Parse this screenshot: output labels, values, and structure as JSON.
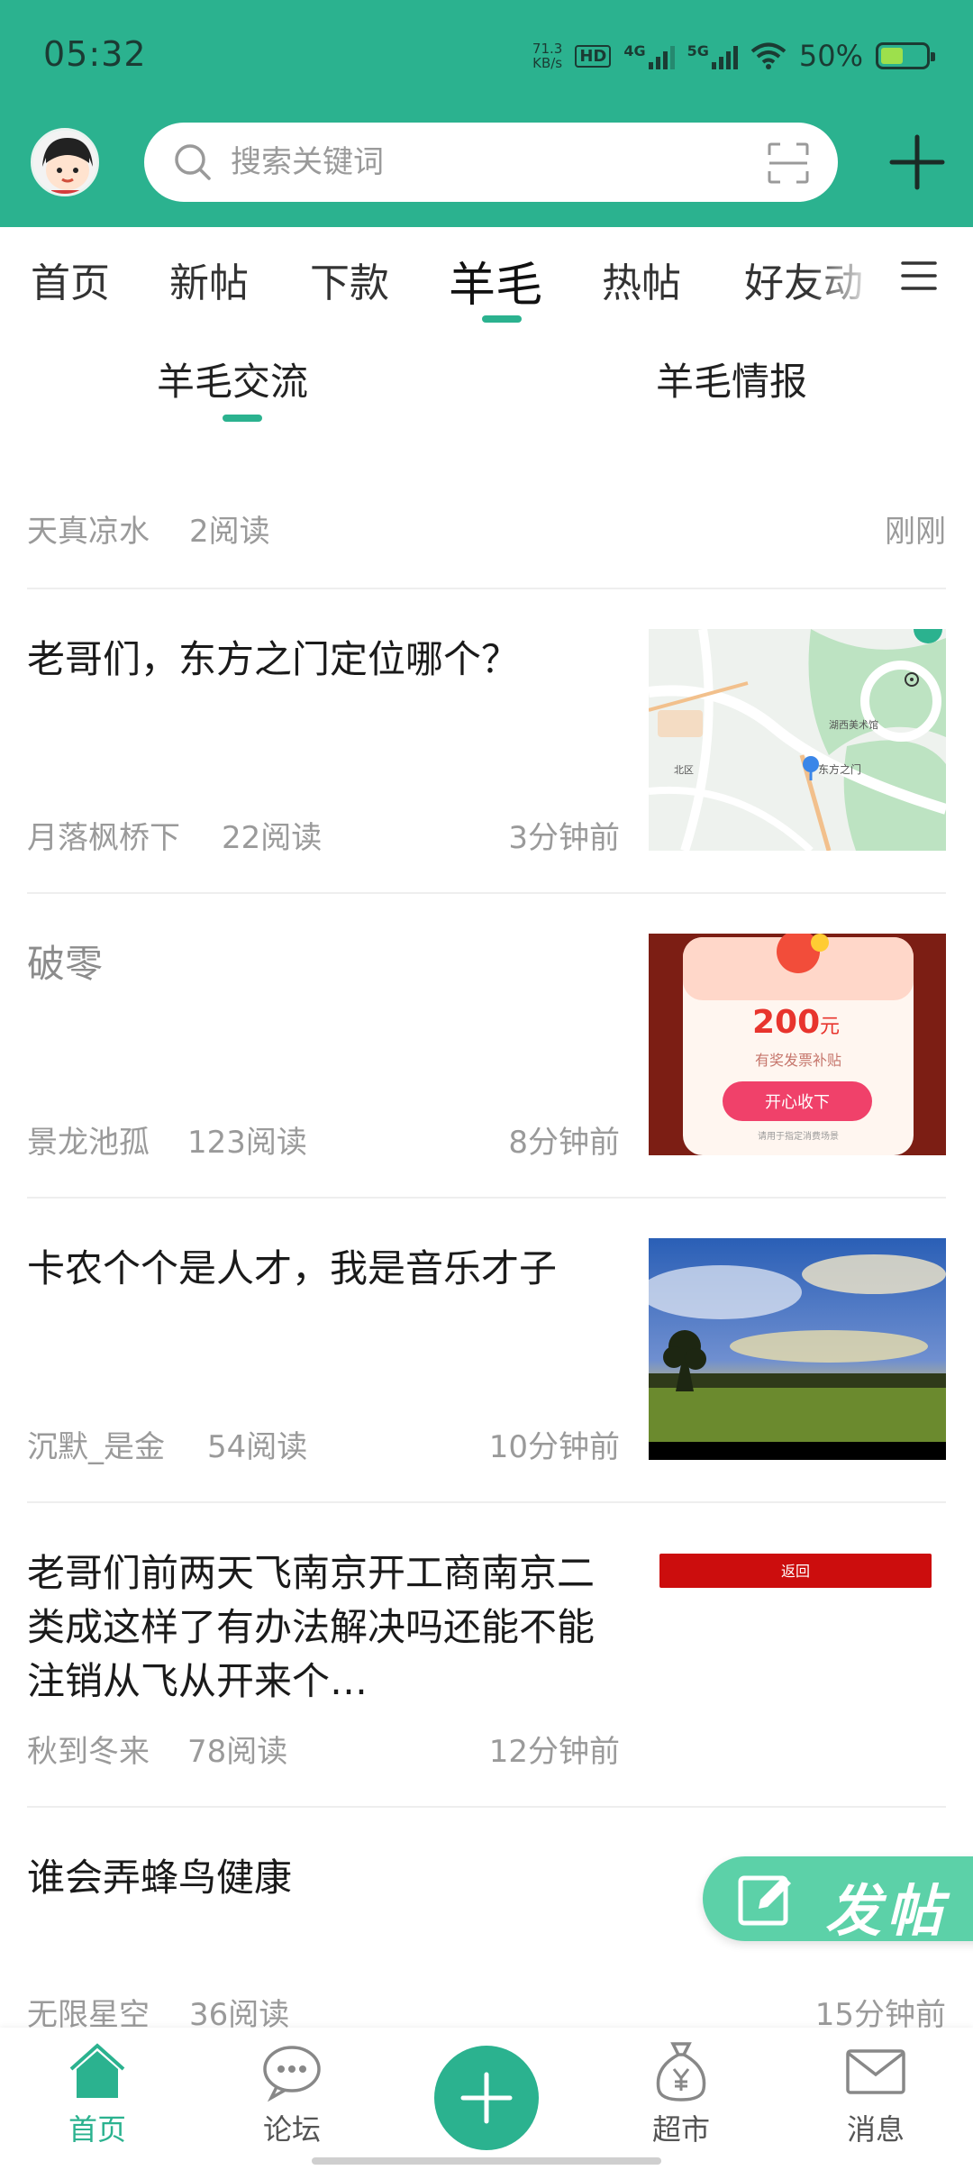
{
  "status_bar": {
    "time": "05:32",
    "net_speed_value": "71.3",
    "net_speed_unit": "KB/s",
    "hd_badge": "HD",
    "signal_1": "4G",
    "signal_2": "5G",
    "battery_percent": "50%",
    "battery_level": 0.5
  },
  "header": {
    "search_placeholder": "搜索关键词",
    "accent_color": "#2bb28f"
  },
  "tabs": [
    {
      "label": "首页"
    },
    {
      "label": "新帖"
    },
    {
      "label": "下款"
    },
    {
      "label": "羊毛",
      "active": true
    },
    {
      "label": "热帖"
    },
    {
      "label": "好友动"
    }
  ],
  "subtabs": [
    {
      "label": "羊毛交流",
      "active": true
    },
    {
      "label": "羊毛情报"
    }
  ],
  "pinned": {
    "author": "天真凉水",
    "reads": "2阅读",
    "time": "刚刚"
  },
  "posts": [
    {
      "title": "老哥们，东方之门定位哪个？",
      "author": "月落枫桥下",
      "reads": "22阅读",
      "time": "3分钟前",
      "thumb": "map-thumb"
    },
    {
      "title": "破零",
      "author": "景龙池孤",
      "reads": "123阅读",
      "time": "8分钟前",
      "thumb": "redpacket-thumb"
    },
    {
      "title": "卡农个个是人才，我是音乐才子",
      "author": "沉默_是金",
      "reads": "54阅读",
      "time": "10分钟前",
      "thumb": "sunset-thumb"
    },
    {
      "title": "老哥们前两天飞南京开工商南京二类成这样了有办法解决吗还能不能注销从飞从开来个…",
      "author": "秋到冬来",
      "reads": "78阅读",
      "time": "12分钟前",
      "thumb": "back-thumb"
    },
    {
      "title": "谁会弄蜂鸟健康",
      "author": "无限星空",
      "reads": "36阅读",
      "time": "15分钟前"
    }
  ],
  "thumbs": {
    "map_labels": [
      "东方之门",
      "湖西美术馆",
      "北区"
    ],
    "redpacket_amount": "200",
    "redpacket_unit": "元",
    "redpacket_desc": "有奖发票补贴",
    "redpacket_button": "开心收下",
    "redpacket_note": "请用于指定消费场景",
    "back_button": "返回"
  },
  "fab": {
    "label": "发帖"
  },
  "bottom_nav": [
    {
      "label": "首页",
      "icon": "home-icon",
      "active": true
    },
    {
      "label": "论坛",
      "icon": "forum-icon"
    },
    {
      "label": "",
      "icon": "add-icon"
    },
    {
      "label": "超市",
      "icon": "money-bag-icon"
    },
    {
      "label": "消息",
      "icon": "mail-icon"
    }
  ]
}
